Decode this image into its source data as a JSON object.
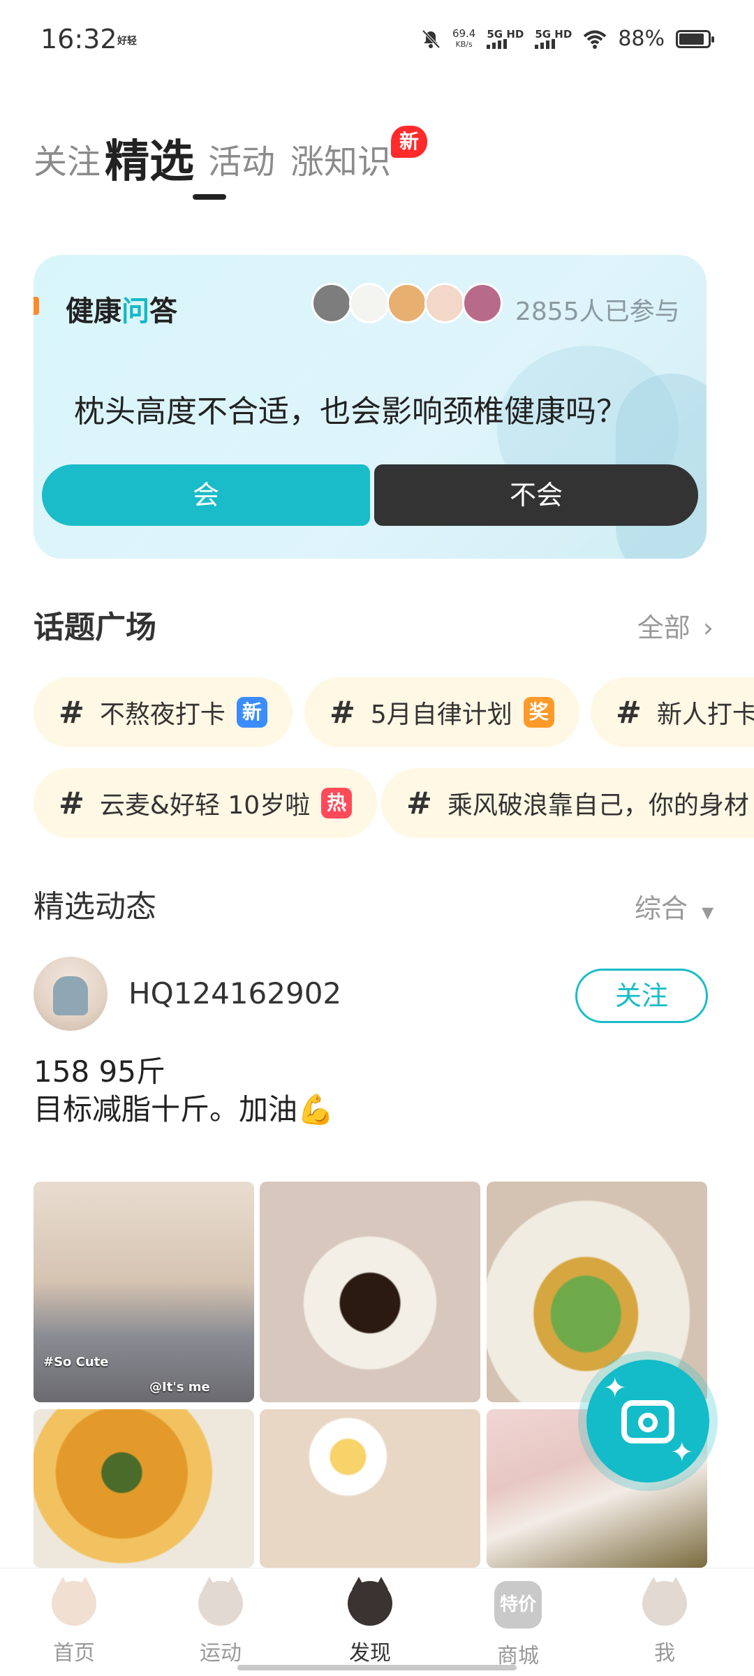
{
  "status_bar": {
    "time": "16:32",
    "app_icon_text": "好轻",
    "net_speed_value": "69.4",
    "net_speed_unit": "KB/s",
    "sim1": "5G HD",
    "sim2": "5G HD",
    "battery_percent_text": "88%",
    "battery_level": 0.88,
    "icons": [
      "mute-icon",
      "signal-icon",
      "wifi-icon",
      "battery-icon"
    ]
  },
  "tabs": [
    {
      "label": "关注",
      "active": false
    },
    {
      "label": "精选",
      "active": true
    },
    {
      "label": "活动",
      "active": false
    },
    {
      "label": "涨知识",
      "active": false
    }
  ],
  "new_badge": "新",
  "health_card": {
    "brand": "健康问答",
    "participants": "2855人已参与",
    "question": "枕头高度不合适，也会影响颈椎健康吗？",
    "yes_label": "会",
    "no_label": "不会",
    "accent_color": "#19bcc8"
  },
  "topics_section": {
    "title": "话题广场",
    "more": "全部",
    "row1": [
      {
        "text": "不熬夜打卡",
        "tag": "新"
      },
      {
        "text": "5月自律计划",
        "tag": "奖"
      },
      {
        "text": "新人打卡"
      }
    ],
    "row2": [
      {
        "text": "云麦&好轻 10岁啦",
        "tag": "热"
      },
      {
        "text": "乘风破浪靠自己，你的身材"
      }
    ]
  },
  "feed": {
    "title": "精选动态",
    "sort": "综合",
    "post": {
      "username": "HQ124162902",
      "follow_label": "关注",
      "line1": "158 95斤",
      "line2": "目标减脂十斤。加油💪"
    },
    "image_captions": {
      "cap1": "#So Cute",
      "cap2": "@It's me"
    }
  },
  "bottom_nav": [
    {
      "label": "首页"
    },
    {
      "label": "运动"
    },
    {
      "label": "发现",
      "active": true
    },
    {
      "label": "商城",
      "icon_text": "特价"
    },
    {
      "label": "我"
    }
  ]
}
